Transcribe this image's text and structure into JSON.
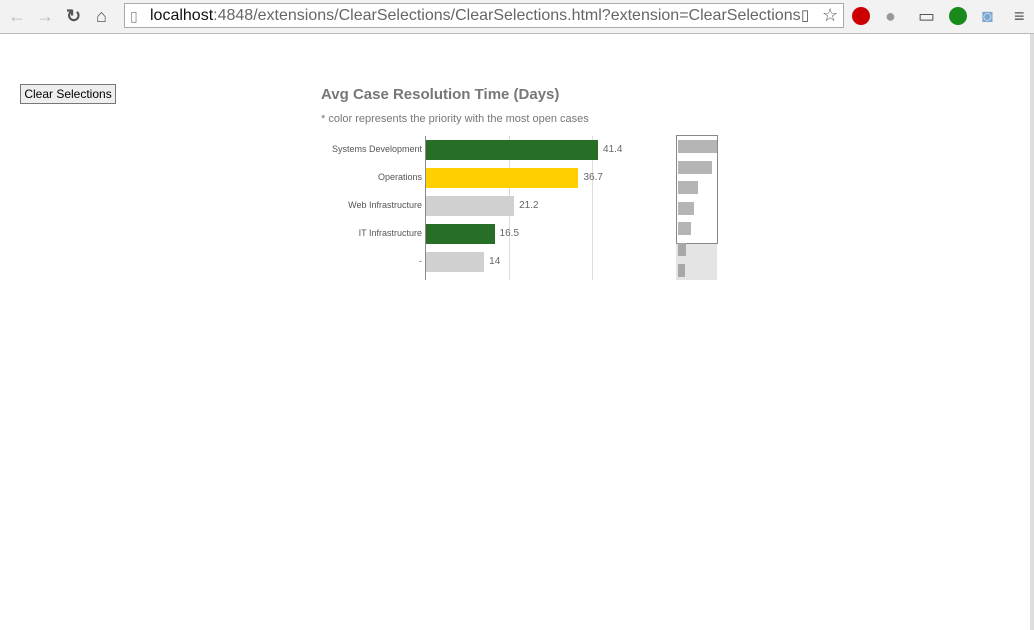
{
  "browser": {
    "url_host": "localhost",
    "url_rest": ":4848/extensions/ClearSelections/ClearSelections.html?extension=ClearSelections",
    "icons": [
      "back-icon",
      "forward-icon",
      "reload-icon",
      "home-icon",
      "page-icon",
      "reader-icon",
      "star-icon",
      "adblock-icon",
      "user-icon",
      "cast-icon",
      "stats-icon",
      "camera-icon",
      "menu-icon"
    ]
  },
  "clear_button": "Clear Selections",
  "chart_data": {
    "type": "bar",
    "orientation": "horizontal",
    "title": "Avg Case Resolution Time (Days)",
    "subtitle": "* color represents the priority with the most open cases",
    "categories": [
      "Systems Development",
      "Operations",
      "Web Infrastructure",
      "IT Infrastructure",
      "-"
    ],
    "values": [
      41.4,
      36.7,
      21.2,
      16.5,
      14
    ],
    "value_labels": [
      "41.4",
      "36.7",
      "21.2",
      "16.5",
      "14"
    ],
    "colors": [
      "#276e27",
      "#ffcf00",
      "#d0d0d0",
      "#276e27",
      "#d0d0d0"
    ],
    "xlim": [
      0,
      60
    ],
    "gridlines": [
      20,
      40
    ],
    "minimap_values": [
      41.4,
      36.7,
      21.2,
      16.5,
      14,
      9,
      7
    ]
  }
}
